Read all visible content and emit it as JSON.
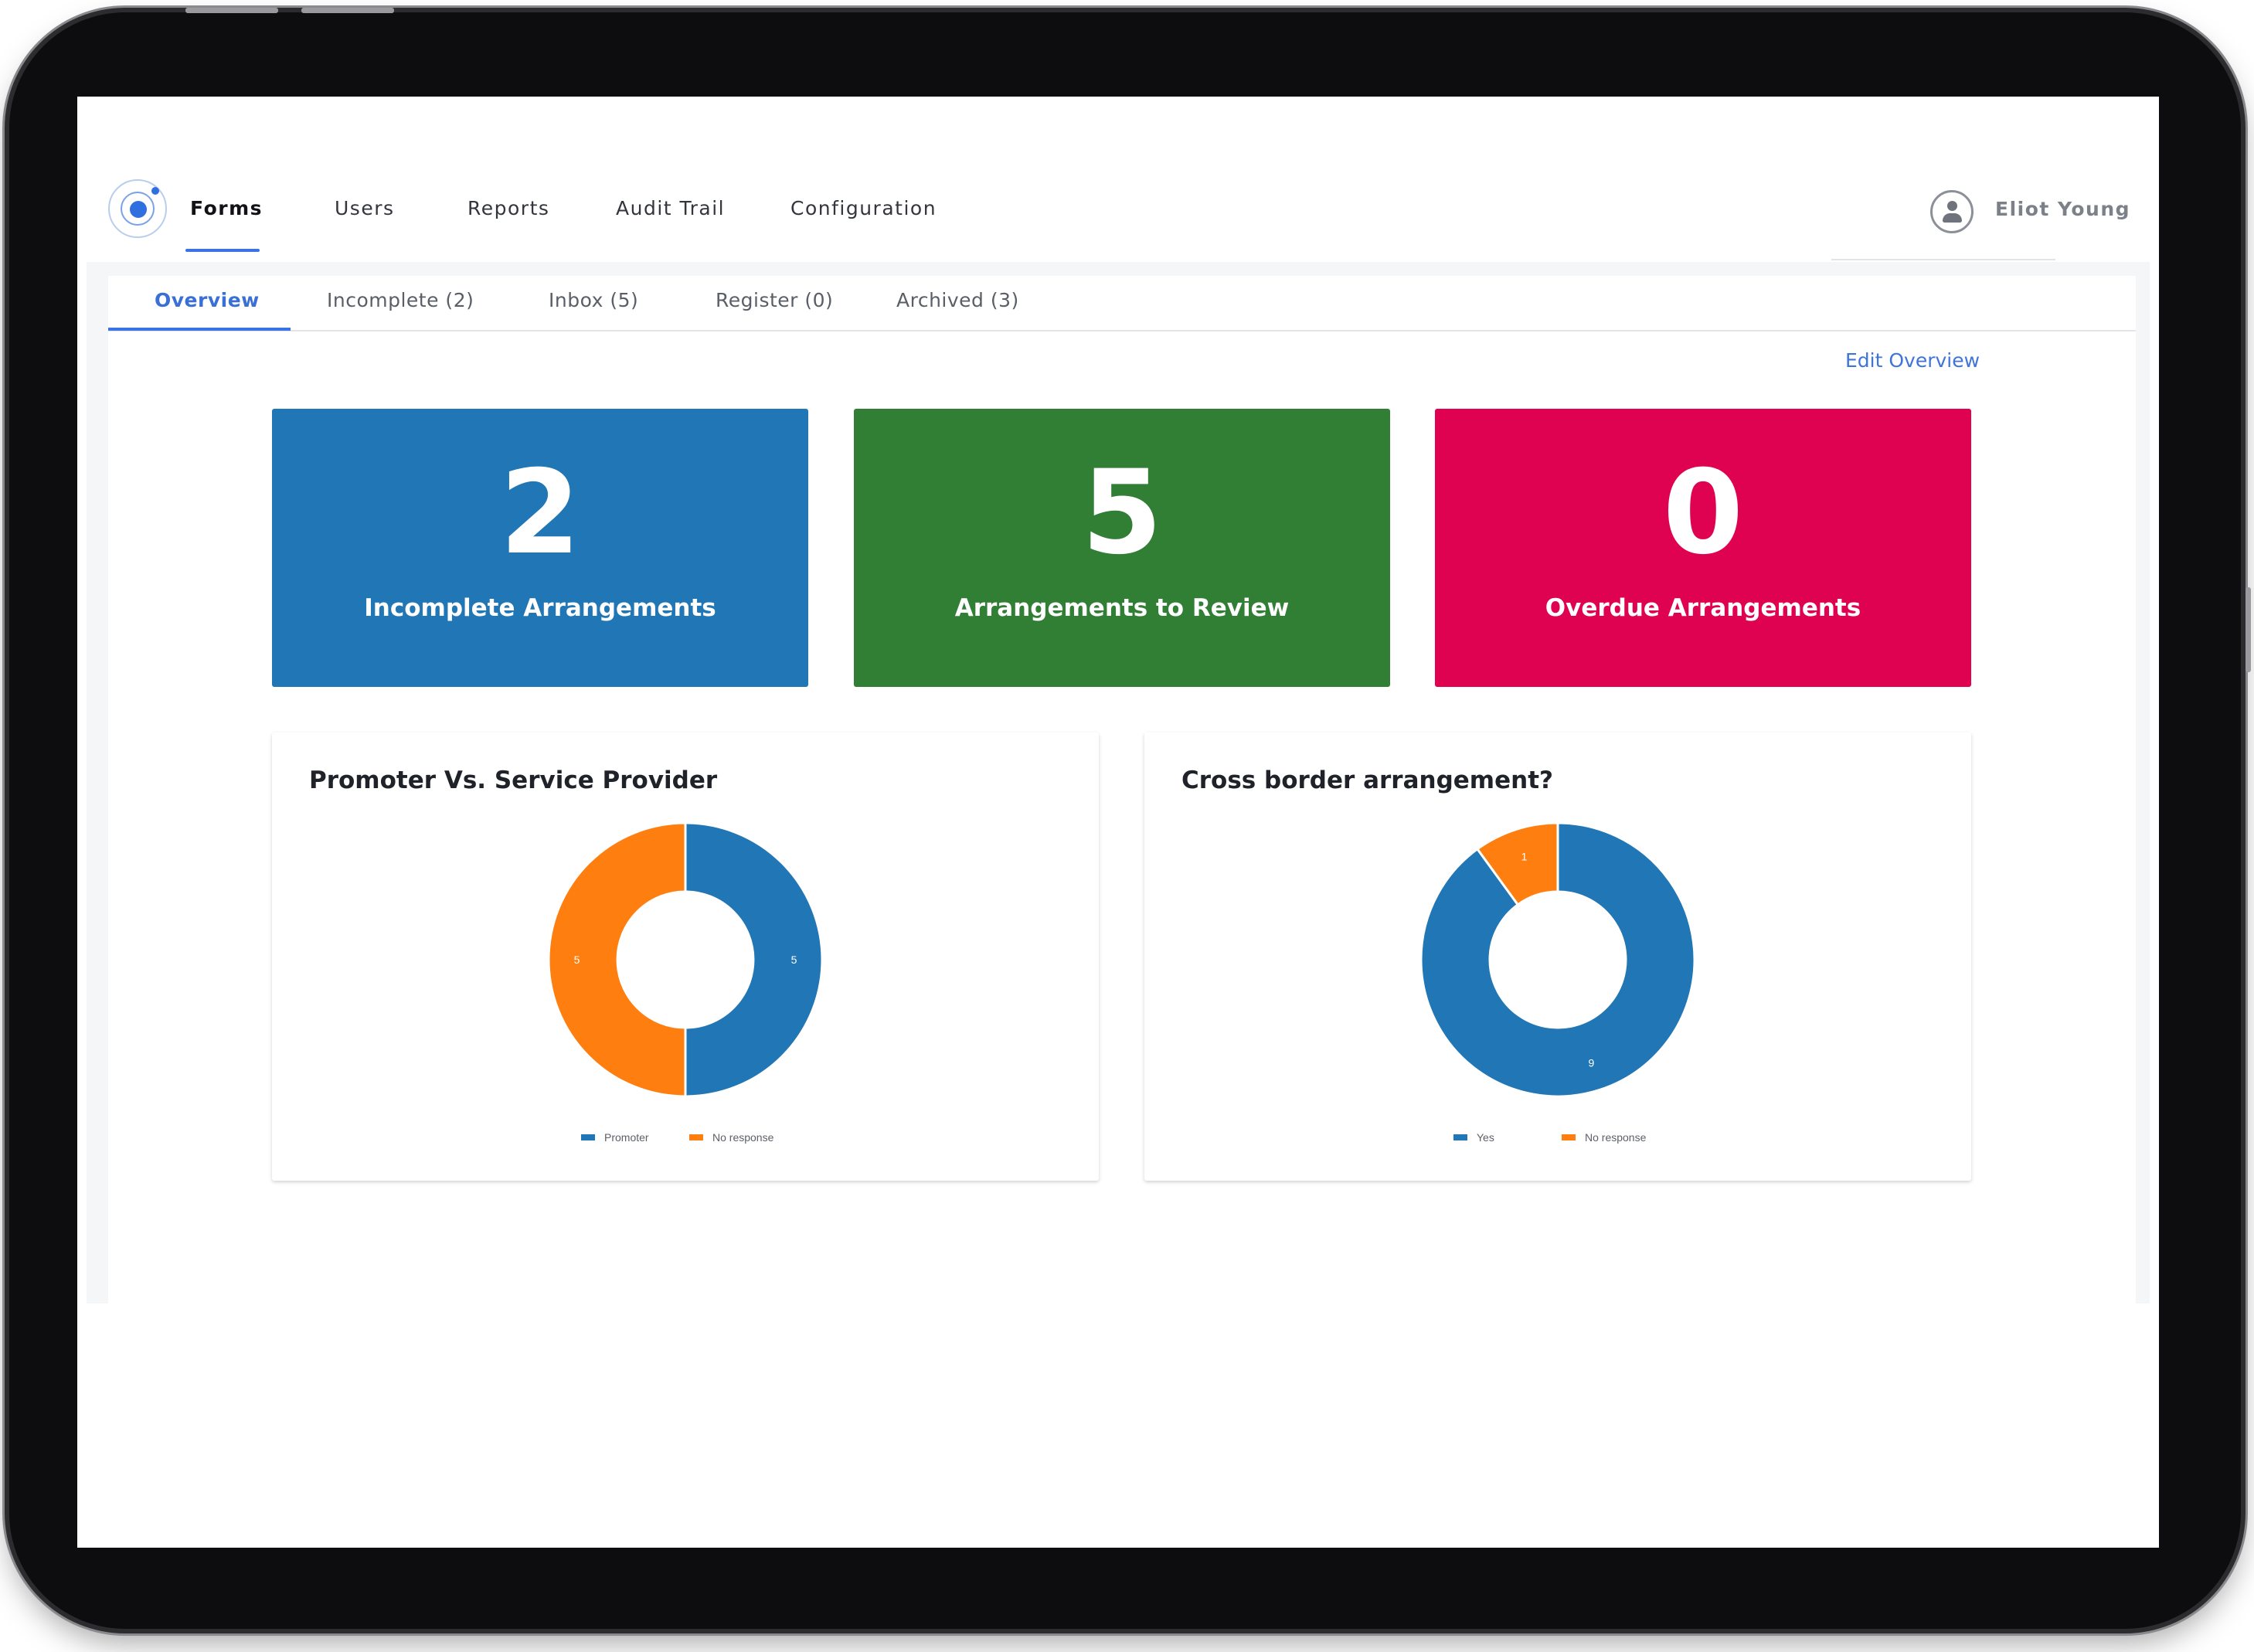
{
  "app": {
    "nav": [
      "Forms",
      "Users",
      "Reports",
      "Audit Trail",
      "Configuration"
    ],
    "active_nav": "Forms",
    "user_name": "Eliot Young"
  },
  "tabs": [
    "Overview",
    "Incomplete (2)",
    "Inbox (5)",
    "Register (0)",
    "Archived (3)"
  ],
  "active_tab": "Overview",
  "edit_link": "Edit Overview",
  "stats": [
    {
      "value": "2",
      "label": "Incomplete Arrangements",
      "color": "#2176b5"
    },
    {
      "value": "5",
      "label": "Arrangements to Review",
      "color": "#317e35"
    },
    {
      "value": "0",
      "label": "Overdue Arrangements",
      "color": "#df0250"
    }
  ],
  "chart_data": [
    {
      "type": "pie",
      "title": "Promoter Vs. Service Provider",
      "categories": [
        "Promoter",
        "No response"
      ],
      "values": [
        5,
        5
      ],
      "colors": [
        "#2176b5",
        "#fe7f0f"
      ],
      "donut": true,
      "legend": "bottom"
    },
    {
      "type": "pie",
      "title": "Cross border arrangement?",
      "categories": [
        "Yes",
        "No response"
      ],
      "values": [
        9,
        1
      ],
      "colors": [
        "#2176b5",
        "#fe7f0f"
      ],
      "donut": true,
      "legend": "bottom"
    }
  ]
}
